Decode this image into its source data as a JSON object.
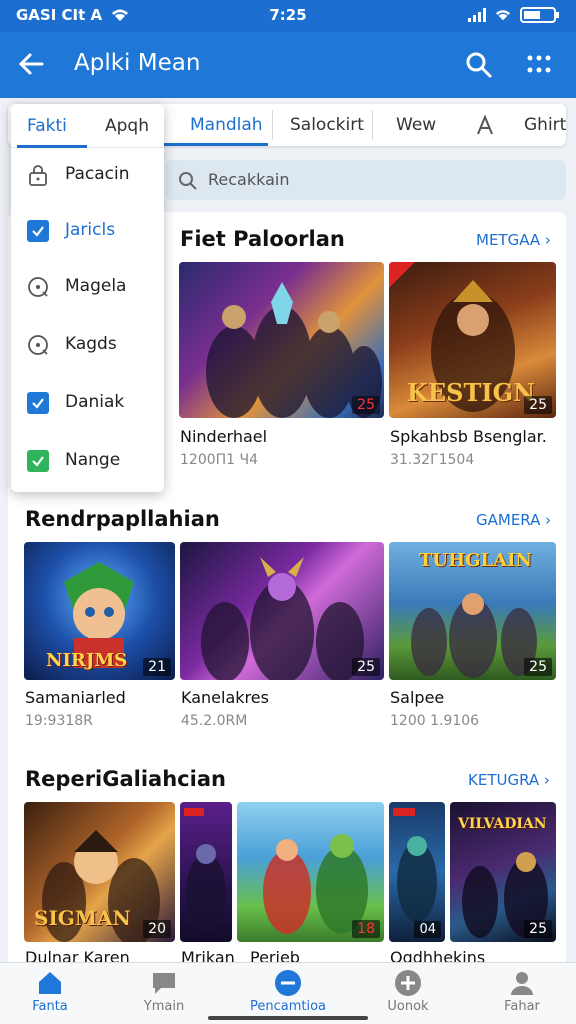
{
  "status": {
    "left_text": "GASI CIt A",
    "time": "7:25"
  },
  "appbar": {
    "title": "Aplki Mean"
  },
  "tabs": [
    {
      "label": "Mandlah"
    },
    {
      "label": "Salockirt"
    },
    {
      "label": "Wew"
    },
    {
      "label": "Ghirt"
    }
  ],
  "dropdown": {
    "header": {
      "active": "Fakti",
      "other": "Apqh"
    },
    "items": [
      {
        "label": "Pacacin",
        "icon": "lock-icon",
        "checked": false
      },
      {
        "label": "Jaricls",
        "icon": "checkbox-checked-icon",
        "checked": true
      },
      {
        "label": "Magela",
        "icon": "search-circle-icon",
        "checked": false
      },
      {
        "label": "Kagds",
        "icon": "search-circle-icon",
        "checked": false
      },
      {
        "label": "Daniak",
        "icon": "checkbox-checked-icon",
        "checked": true
      },
      {
        "label": "Nange",
        "icon": "checkbox-checked-green-icon",
        "checked": true
      }
    ]
  },
  "search": {
    "placeholder": "Recakkain"
  },
  "sections": [
    {
      "title": "Fiet Paloorlan",
      "link": "METGAA",
      "games": [
        {
          "name": "Ninderhael",
          "size": "1200П1 Ч4",
          "badge": "25"
        },
        {
          "name": "Spkahbsb Bsenglar.",
          "size": "31.32Г1504",
          "badge": "25",
          "cover_text": "KESTIGN"
        }
      ]
    },
    {
      "title": "Rendrpapllahian",
      "link": "GAMERA",
      "games": [
        {
          "name": "Samaniarled",
          "size": "19:9318R",
          "badge": "21",
          "cover_text": "NIRJMS"
        },
        {
          "name": "Kanelakres",
          "size": "45.2.0RM",
          "badge": "25"
        },
        {
          "name": "Salpee",
          "size": "1200 1.9106",
          "badge": "25",
          "cover_text": "TUHGLAIN"
        }
      ]
    },
    {
      "title": "ReperiGaliahcian",
      "link": "KETUGRA",
      "games": [
        {
          "name": "Dulnar Karen",
          "badge": "20",
          "cover_text": "SIGMAN"
        },
        {
          "name": "Mrikan",
          "badge": ""
        },
        {
          "name": "Perieb",
          "badge": "18"
        },
        {
          "name": "Ogdhhekins",
          "badge": "04"
        },
        {
          "name": "",
          "badge": "25",
          "cover_text": "VILVADIAN"
        }
      ]
    }
  ],
  "nav": [
    {
      "label": "Fanta",
      "icon": "home-icon",
      "active": true
    },
    {
      "label": "Ymain",
      "icon": "chat-icon",
      "active": false
    },
    {
      "label": "Pencamtioa",
      "icon": "minus-circle-icon",
      "active": true
    },
    {
      "label": "Uonok",
      "icon": "plus-circle-icon",
      "active": false
    },
    {
      "label": "Fahar",
      "icon": "person-icon",
      "active": false
    }
  ],
  "colors": {
    "primary": "#1f78d8",
    "accent": "#1d6fd0",
    "check_green": "#2fb35b"
  }
}
